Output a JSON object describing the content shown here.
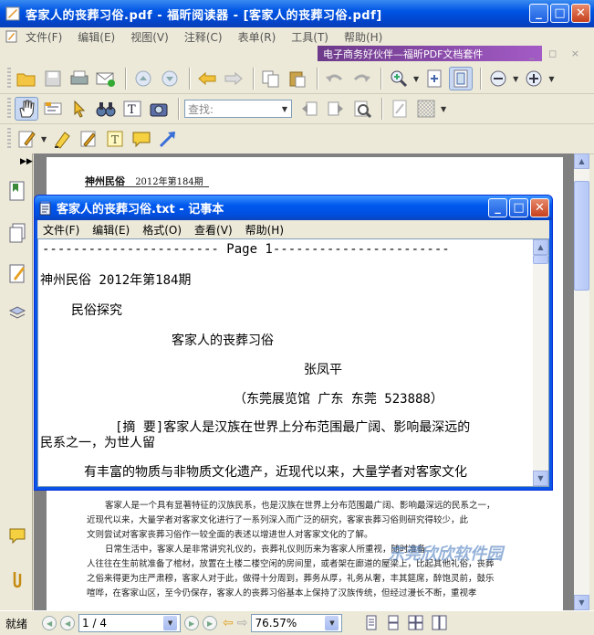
{
  "app": {
    "title": "客家人的丧葬习俗.pdf - 福昕阅读器 - [客家人的丧葬习俗.pdf]"
  },
  "menu": {
    "items": [
      "文件(F)",
      "编辑(E)",
      "视图(V)",
      "注释(C)",
      "表单(R)",
      "工具(T)",
      "帮助(H)"
    ],
    "promo": "电子商务好伙伴—福昕PDF文档套件"
  },
  "toolbar": {
    "search_placeholder": "查找:"
  },
  "pdf": {
    "header_journal": "神州民俗",
    "header_issue": "2012年第184期",
    "body": [
      "客家人是一个具有显著特征的汉族民系，也是汉族在世界上分布范围最广阔、影响最深远的民系之一，",
      "近现代以来，大量学者对客家文化进行了一系列深入而广泛的研究，客家丧葬习俗则研究得较少，此",
      "文则尝试对客家丧葬习俗作一较全面的表述以增进世人对客家文化的了解。",
      "日常生活中，客家人是非常讲究礼仪的，丧葬礼仪则历来为客家人所重视，随时准备",
      "人往往在生前就准备了棺材，放置在土楼二楼空闲的房间里，或者架在廊道的屋梁上，比起其他礼俗，丧葬",
      "之俗来得更为庄严肃穆，客家人对于此，做得十分周到，葬务从厚，礼务从奢，丰其筵席，醉饱灵前，鼓乐",
      "喧哗，在客家山区，至今仍保存，客家人的丧葬习俗基本上保持了汉族传统，但经过漫长不断，重视孝"
    ],
    "watermark": "东莞欣欣软件园"
  },
  "notepad": {
    "title": "客家人的丧葬习俗.txt - 记事本",
    "menu": [
      "文件(F)",
      "编辑(E)",
      "格式(O)",
      "查看(V)",
      "帮助(H)"
    ],
    "lines": [
      "----------------------- Page 1-----------------------",
      "神州民俗 2012年第184期",
      "民俗探究",
      "客家人的丧葬习俗",
      "张凤平",
      "（东莞展览馆 广东 东莞 523888）",
      "[摘  要]客家人是汉族在世界上分布范围最广阔、影响最深远的",
      "民系之一，为世人留",
      "有丰富的物质与非物质文化遗产，近现代以来，大量学者对客家文化"
    ]
  },
  "status": {
    "ready": "就绪",
    "page": "1 / 4",
    "zoom": "76.57%"
  }
}
